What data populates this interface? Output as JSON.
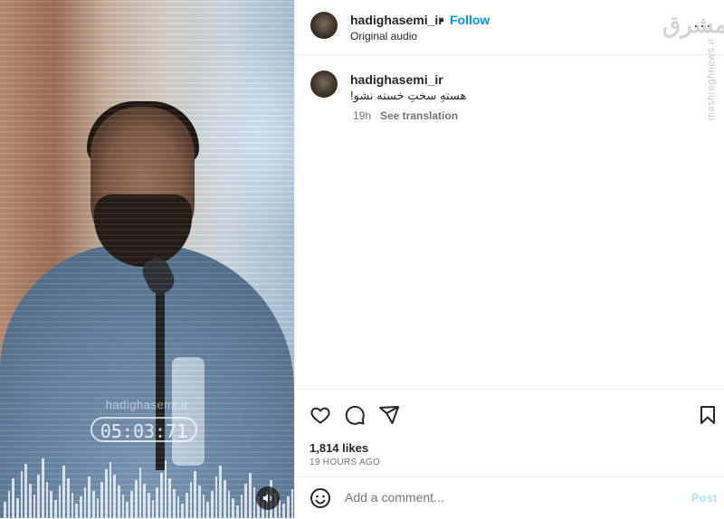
{
  "media": {
    "overlay_username": "hadighasemi.ir",
    "timer": "05:03:71",
    "mute_icon": "speaker-icon"
  },
  "header": {
    "username": "hadighasemi_ir",
    "separator": "•",
    "follow_label": "Follow",
    "audio_label": "Original audio",
    "more_label": "···"
  },
  "watermark": {
    "logo_text": "مشرق",
    "site_text": "mashreghnews.ir"
  },
  "caption": {
    "username": "hadighasemi_ir",
    "dot": ".",
    "text": "هستهِ سختِ خسته نشو!",
    "time": "19h",
    "translation_label": "See translation"
  },
  "actions": {
    "icons": [
      "heart-icon",
      "comment-icon",
      "share-icon",
      "bookmark-icon"
    ],
    "likes": "1,814 likes",
    "time_ago": "19 HOURS AGO"
  },
  "comment": {
    "placeholder": "Add a comment...",
    "post_label": "Post"
  },
  "colors": {
    "accent": "#0095f6",
    "post_disabled": "#b2dffc",
    "muted_text": "#737373"
  }
}
